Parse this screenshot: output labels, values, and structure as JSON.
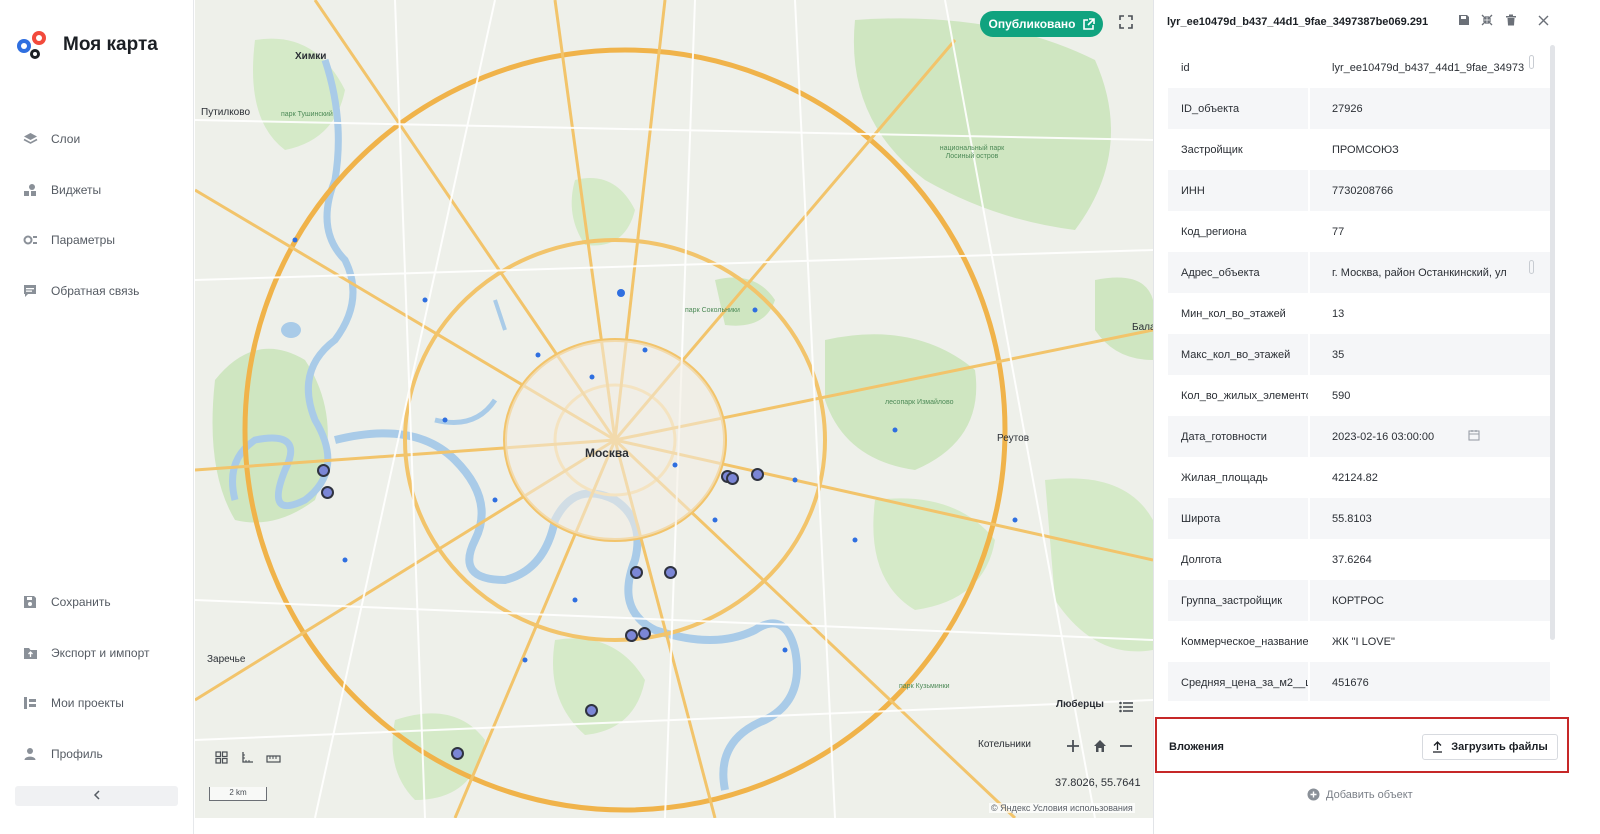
{
  "app": {
    "title": "Моя карта"
  },
  "nav_top": [
    {
      "label": "Слои",
      "icon": "layers-icon"
    },
    {
      "label": "Виджеты",
      "icon": "widgets-icon"
    },
    {
      "label": "Параметры",
      "icon": "settings-icon"
    },
    {
      "label": "Обратная связь",
      "icon": "feedback-icon"
    }
  ],
  "nav_bottom": [
    {
      "label": "Сохранить",
      "icon": "save-icon"
    },
    {
      "label": "Экспорт и импорт",
      "icon": "export-import-icon"
    },
    {
      "label": "Мои проекты",
      "icon": "projects-icon"
    },
    {
      "label": "Профиль",
      "icon": "profile-icon"
    }
  ],
  "map": {
    "publish_label": "Опубликовано",
    "scale": "2 km",
    "coordinates": "37.8026, 55.7641",
    "attribution": "© Яндекс Условия использования",
    "cities": {
      "moscow": "Москва",
      "khimki": "Химки",
      "putilkovo": "Путилково",
      "reutov": "Реутов",
      "lyubertsy": "Люберцы",
      "kotelniki": "Котельники",
      "zarechye": "Заречье",
      "bala": "Бала"
    },
    "parks": {
      "sokolniki": "парк Сокольники",
      "tushinsky": "парк Тушинский",
      "izmaylovo": "лесопарк Измайлово",
      "kuzminki": "парк Кузьминки",
      "losiny": "национальный парк Лосиный остров"
    }
  },
  "panel": {
    "title": "lyr_ee10479d_b437_44d1_9fae_3497387be069.291",
    "attributes": [
      {
        "key": "id",
        "value": "lyr_ee10479d_b437_44d1_9fae_34973"
      },
      {
        "key": "ID_объекта",
        "value": "27926"
      },
      {
        "key": "Застройщик",
        "value": "ПРОМСОЮЗ"
      },
      {
        "key": "ИНН",
        "value": "7730208766"
      },
      {
        "key": "Код_региона",
        "value": "77"
      },
      {
        "key": "Адрес_объекта",
        "value": "г. Москва, район Останкинский, ул"
      },
      {
        "key": "Мин_кол_во_этажей",
        "value": "13"
      },
      {
        "key": "Макс_кол_во_этажей",
        "value": "35"
      },
      {
        "key": "Кол_во_жилых_элементов",
        "value": "590"
      },
      {
        "key": "Дата_готовности",
        "value": "2023-02-16 03:00:00"
      },
      {
        "key": "Жилая_площадь",
        "value": "42124.82"
      },
      {
        "key": "Широта",
        "value": "55.8103"
      },
      {
        "key": "Долгота",
        "value": "37.6264"
      },
      {
        "key": "Группа_застройщик",
        "value": "КОРТРОС"
      },
      {
        "key": "Коммерческое_название",
        "value": "ЖК \"I LOVE\""
      },
      {
        "key": "Средняя_цена_за_м2__ц",
        "value": "451676"
      }
    ],
    "attachments_label": "Вложения",
    "upload_label": "Загрузить файлы",
    "add_object_label": "Добавить объект"
  },
  "colors": {
    "accent": "#10a37f",
    "highlight_border": "#c62828",
    "marker_fill": "#7b86d6"
  }
}
